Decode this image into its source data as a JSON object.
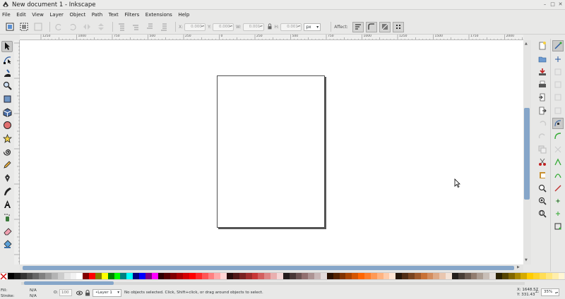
{
  "window": {
    "title": "New document 1 - Inkscape"
  },
  "menu": [
    "File",
    "Edit",
    "View",
    "Layer",
    "Object",
    "Path",
    "Text",
    "Filters",
    "Extensions",
    "Help"
  ],
  "toolctl": {
    "x_label": "X:",
    "x_value": "0.000",
    "y_label": "Y:",
    "y_value": "0.000",
    "w_label": "W:",
    "w_value": "0.001",
    "h_label": "H:",
    "h_value": "0.001",
    "unit": "px",
    "affect_label": "Affect:"
  },
  "ruler": {
    "h_ticks": [
      "1250",
      "1000",
      "750",
      "500",
      "250",
      "0",
      "250",
      "500",
      "750",
      "1000",
      "1250",
      "1500",
      "1750",
      "2000",
      "2250"
    ]
  },
  "tools": [
    "selector-icon",
    "node-icon",
    "tweak-icon",
    "zoom-icon",
    "rect-icon",
    "3dbox-icon",
    "ellipse-icon",
    "star-icon",
    "spiral-icon",
    "pencil-icon",
    "pen-icon",
    "calligraphy-icon",
    "text-icon",
    "spray-icon",
    "eraser-icon",
    "bucket-icon"
  ],
  "commands": [
    "new-icon",
    "open-icon",
    "save-icon",
    "print-icon",
    "import-icon",
    "export-icon",
    "undo-icon",
    "redo-icon",
    "copy-icon",
    "cut-icon",
    "paste-icon",
    "zoom-selection-icon",
    "zoom-drawing-icon",
    "zoom-page-icon"
  ],
  "snaps": [
    "snap-enable-icon",
    "snap-bbox-icon",
    "snap-bbox-edge-icon",
    "snap-bbox-corner-icon",
    "snap-bbox-mid-icon",
    "snap-nodes-icon",
    "snap-path-icon",
    "snap-intersection-icon",
    "snap-cusp-icon",
    "snap-smooth-icon",
    "snap-midpoint-icon",
    "snap-center-icon",
    "snap-rotation-icon",
    "snap-page-icon"
  ],
  "palette": [
    "#000000",
    "#1a1a1a",
    "#333333",
    "#4d4d4d",
    "#666666",
    "#808080",
    "#999999",
    "#b3b3b3",
    "#cccccc",
    "#e6e6e6",
    "#f2f2f2",
    "#ffffff",
    "#800000",
    "#ff0000",
    "#808000",
    "#ffff00",
    "#008000",
    "#00ff00",
    "#008080",
    "#00ffff",
    "#000080",
    "#0000ff",
    "#800080",
    "#ff00ff",
    "#2b0000",
    "#550000",
    "#800000",
    "#aa0000",
    "#d40000",
    "#ff0000",
    "#ff2a2a",
    "#ff5555",
    "#ff8080",
    "#ffaaaa",
    "#ffd5d5",
    "#280b0b",
    "#501616",
    "#782121",
    "#a02c2c",
    "#c83737",
    "#d35f5f",
    "#de8787",
    "#e9afaf",
    "#f4d7d7",
    "#241c1c",
    "#483737",
    "#6c5353",
    "#916f6f",
    "#ac9393",
    "#c8b7b7",
    "#e3dbdb",
    "#2b1100",
    "#552200",
    "#803300",
    "#aa4400",
    "#d45500",
    "#ff6600",
    "#ff7f2a",
    "#ff9955",
    "#ffb380",
    "#ffccaa",
    "#ffe6d5",
    "#28170b",
    "#502d16",
    "#784421",
    "#a05a2c",
    "#c87137",
    "#d38d5f",
    "#deaa87",
    "#e9c6af",
    "#f4e3d7",
    "#241f1c",
    "#483e37",
    "#6c5d53",
    "#917c6f",
    "#ac9d93",
    "#c8beb7",
    "#e3dedb",
    "#2b2200",
    "#554400",
    "#806600",
    "#aa8800",
    "#d4aa00",
    "#ffcc00",
    "#ffd42a",
    "#ffdd55",
    "#ffe680",
    "#ffeeaa",
    "#fff6d5"
  ],
  "status": {
    "fill_label": "Fill:",
    "fill_value": "N/A",
    "stroke_label": "Stroke:",
    "stroke_value": "N/A",
    "opacity_label": "O:",
    "opacity_value": "100",
    "layer": "•Layer 1",
    "message": "No objects selected. Click, Shift+click, or drag around objects to select.",
    "x_coord": "X: 1648.57",
    "y_coord": "Y:   331.43",
    "zoom_label": "Z:",
    "zoom": "35%"
  }
}
